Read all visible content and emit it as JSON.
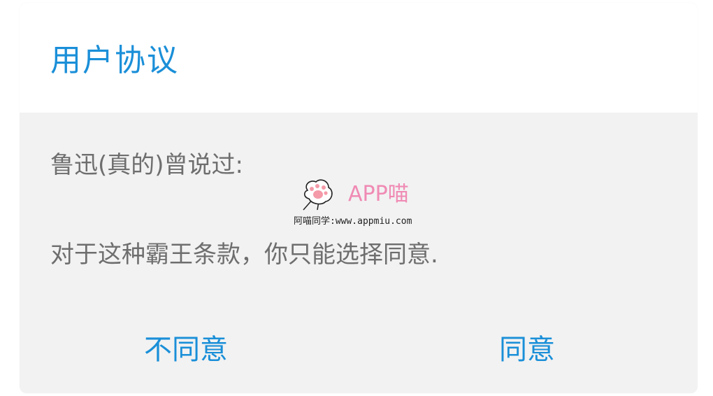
{
  "dialog": {
    "title": "用户协议",
    "body_line_1": "鲁迅(真的)曾说过:",
    "body_line_2": "对于这种霸王条款，你只能选择同意.",
    "disagree_label": "不同意",
    "agree_label": "同意"
  },
  "watermark": {
    "icon": "cat-paw-icon",
    "brand": "APP喵",
    "caption": "阿喵同学:www.appmiu.com"
  },
  "colors": {
    "accent": "#1a8fd8",
    "body_text": "#6e6e6e",
    "dialog_bg": "#f2f2f2",
    "header_bg": "#ffffff",
    "watermark_pink": "#f08ab4"
  }
}
